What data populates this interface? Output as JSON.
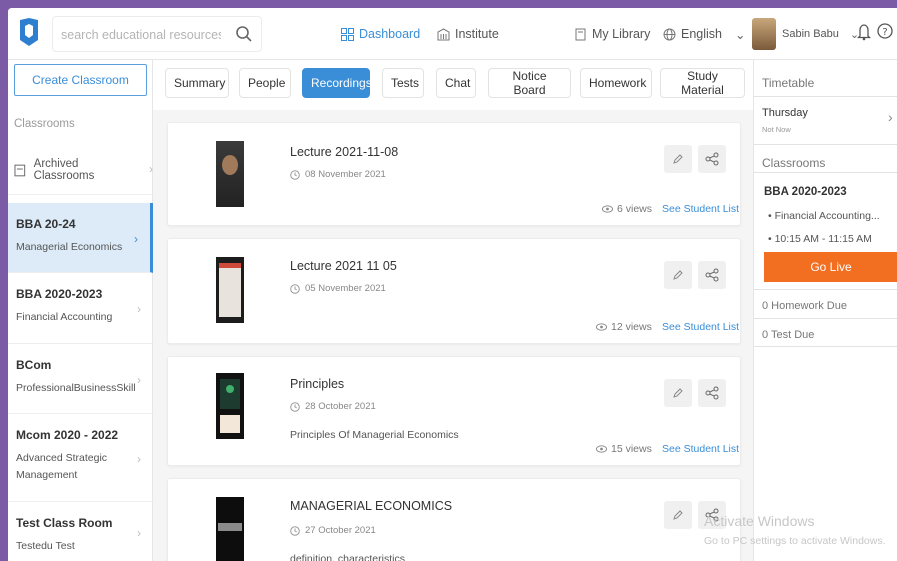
{
  "header": {
    "search_placeholder": "search educational resources",
    "nav": {
      "dashboard": "Dashboard",
      "institute": "Institute",
      "my_library": "My Library",
      "language": "English"
    },
    "user_name": "Sabin Babu"
  },
  "sidebar": {
    "create_label": "Create Classroom",
    "section_label": "Classrooms",
    "archived_label": "Archived Classrooms",
    "classes": [
      {
        "title": "BBA 20-24",
        "subtitle": "Managerial Economics"
      },
      {
        "title": "BBA 2020-2023",
        "subtitle": "Financial Accounting"
      },
      {
        "title": "BCom",
        "subtitle": "ProfessionalBusinessSkill"
      },
      {
        "title": "Mcom 2020 - 2022",
        "subtitle": "Advanced Strategic Management"
      },
      {
        "title": "Test Class Room",
        "subtitle": "Testedu Test"
      }
    ]
  },
  "tabs": [
    "Summary",
    "People",
    "Recordings",
    "Tests",
    "Chat",
    "Notice Board",
    "Homework",
    "Study Material"
  ],
  "recordings": [
    {
      "title": "Lecture 2021-11-08",
      "date": "08 November 2021",
      "desc": "",
      "views": "6 views",
      "link": "See Student List"
    },
    {
      "title": "Lecture 2021 11 05",
      "date": "05 November 2021",
      "desc": "",
      "views": "12 views",
      "link": "See Student List"
    },
    {
      "title": "Principles",
      "date": "28 October 2021",
      "desc": "Principles Of Managerial Economics",
      "views": "15 views",
      "link": "See Student List"
    },
    {
      "title": "MANAGERIAL ECONOMICS",
      "date": "27 October 2021",
      "desc": "definition, characteristics",
      "views": "",
      "link": ""
    }
  ],
  "right_panel": {
    "timetable_label": "Timetable",
    "day": "Thursday",
    "day_sub": "Not Now",
    "classrooms_label": "Classrooms",
    "class_title": "BBA 2020-2023",
    "class_subject": "Financial Accounting...",
    "class_time": "10:15 AM - 11:15 AM",
    "go_live": "Go Live",
    "homework_due": "0 Homework Due",
    "test_due": "0 Test Due"
  },
  "watermark": {
    "line1": "Activate Windows",
    "line2": "Go to PC settings to activate Windows."
  },
  "colors": {
    "accent": "#3a8ed8",
    "go_live": "#f26f22",
    "frame": "#7b5aa6"
  }
}
